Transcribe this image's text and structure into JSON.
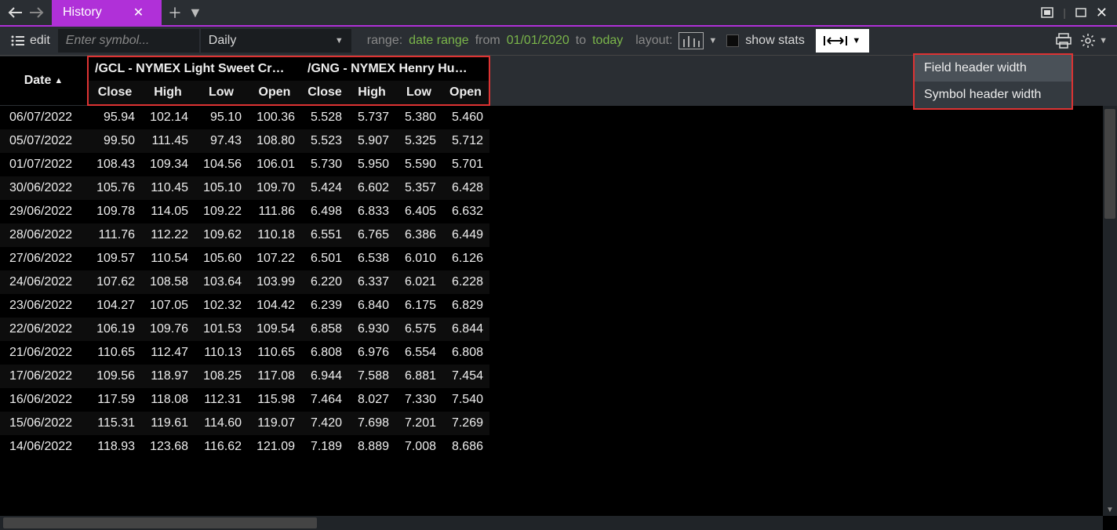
{
  "tab": {
    "title": "History"
  },
  "toolbar": {
    "edit_label": "edit",
    "symbol_placeholder": "Enter symbol...",
    "period": "Daily",
    "range_label": "range:",
    "date_range_label": "date range",
    "from_label": "from",
    "from_value": "01/01/2020",
    "to_label": "to",
    "to_value": "today",
    "layout_label": "layout:",
    "show_stats_label": "show stats"
  },
  "dropdown": {
    "items": [
      "Field header width",
      "Symbol header width"
    ]
  },
  "table": {
    "date_header": "Date",
    "symbols": [
      {
        "label": "/GCL - NYMEX Light Sweet Cr…",
        "fields": [
          "Close",
          "High",
          "Low",
          "Open"
        ]
      },
      {
        "label": "/GNG - NYMEX Henry Hu…",
        "fields": [
          "Close",
          "High",
          "Low",
          "Open"
        ]
      }
    ],
    "rows": [
      {
        "date": "06/07/2022",
        "a": [
          "95.94",
          "102.14",
          "95.10",
          "100.36"
        ],
        "b": [
          "5.528",
          "5.737",
          "5.380",
          "5.460"
        ]
      },
      {
        "date": "05/07/2022",
        "a": [
          "99.50",
          "111.45",
          "97.43",
          "108.80"
        ],
        "b": [
          "5.523",
          "5.907",
          "5.325",
          "5.712"
        ]
      },
      {
        "date": "01/07/2022",
        "a": [
          "108.43",
          "109.34",
          "104.56",
          "106.01"
        ],
        "b": [
          "5.730",
          "5.950",
          "5.590",
          "5.701"
        ]
      },
      {
        "date": "30/06/2022",
        "a": [
          "105.76",
          "110.45",
          "105.10",
          "109.70"
        ],
        "b": [
          "5.424",
          "6.602",
          "5.357",
          "6.428"
        ]
      },
      {
        "date": "29/06/2022",
        "a": [
          "109.78",
          "114.05",
          "109.22",
          "111.86"
        ],
        "b": [
          "6.498",
          "6.833",
          "6.405",
          "6.632"
        ]
      },
      {
        "date": "28/06/2022",
        "a": [
          "111.76",
          "112.22",
          "109.62",
          "110.18"
        ],
        "b": [
          "6.551",
          "6.765",
          "6.386",
          "6.449"
        ]
      },
      {
        "date": "27/06/2022",
        "a": [
          "109.57",
          "110.54",
          "105.60",
          "107.22"
        ],
        "b": [
          "6.501",
          "6.538",
          "6.010",
          "6.126"
        ]
      },
      {
        "date": "24/06/2022",
        "a": [
          "107.62",
          "108.58",
          "103.64",
          "103.99"
        ],
        "b": [
          "6.220",
          "6.337",
          "6.021",
          "6.228"
        ]
      },
      {
        "date": "23/06/2022",
        "a": [
          "104.27",
          "107.05",
          "102.32",
          "104.42"
        ],
        "b": [
          "6.239",
          "6.840",
          "6.175",
          "6.829"
        ]
      },
      {
        "date": "22/06/2022",
        "a": [
          "106.19",
          "109.76",
          "101.53",
          "109.54"
        ],
        "b": [
          "6.858",
          "6.930",
          "6.575",
          "6.844"
        ]
      },
      {
        "date": "21/06/2022",
        "a": [
          "110.65",
          "112.47",
          "110.13",
          "110.65"
        ],
        "b": [
          "6.808",
          "6.976",
          "6.554",
          "6.808"
        ]
      },
      {
        "date": "17/06/2022",
        "a": [
          "109.56",
          "118.97",
          "108.25",
          "117.08"
        ],
        "b": [
          "6.944",
          "7.588",
          "6.881",
          "7.454"
        ]
      },
      {
        "date": "16/06/2022",
        "a": [
          "117.59",
          "118.08",
          "112.31",
          "115.98"
        ],
        "b": [
          "7.464",
          "8.027",
          "7.330",
          "7.540"
        ]
      },
      {
        "date": "15/06/2022",
        "a": [
          "115.31",
          "119.61",
          "114.60",
          "119.07"
        ],
        "b": [
          "7.420",
          "7.698",
          "7.201",
          "7.269"
        ]
      },
      {
        "date": "14/06/2022",
        "a": [
          "118.93",
          "123.68",
          "116.62",
          "121.09"
        ],
        "b": [
          "7.189",
          "8.889",
          "7.008",
          "8.686"
        ]
      }
    ]
  }
}
